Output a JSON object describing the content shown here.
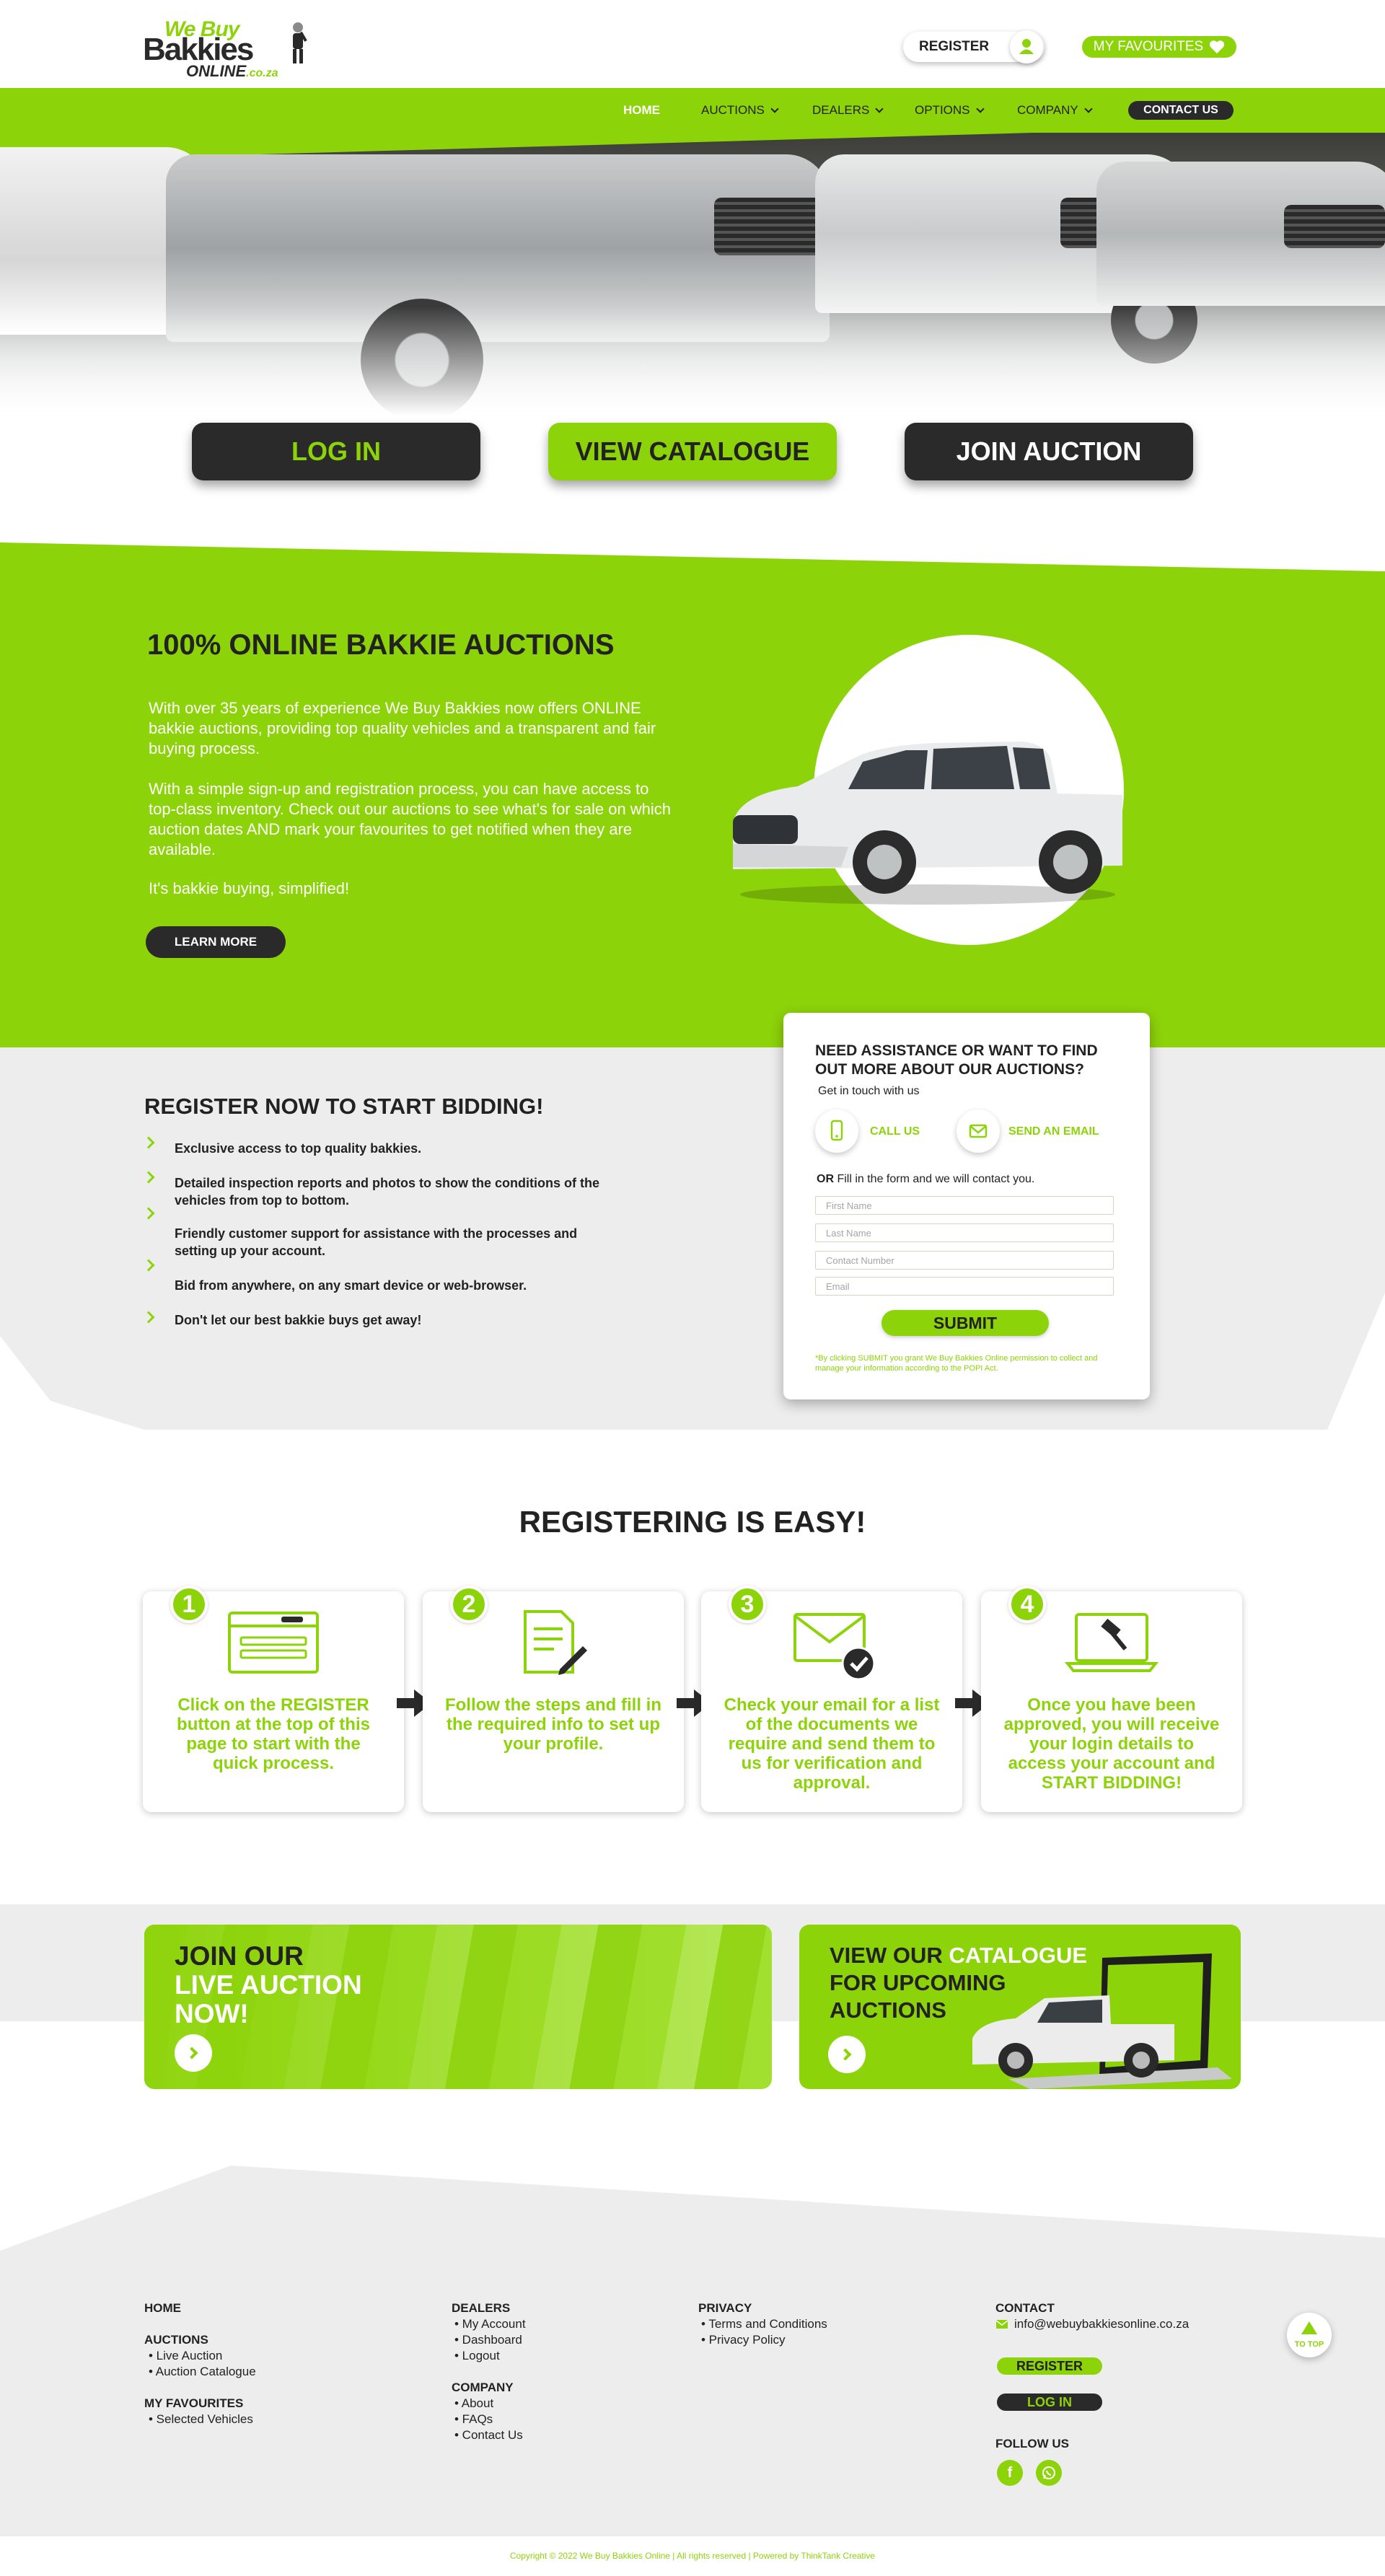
{
  "brand": {
    "logo_line1": "We Buy",
    "logo_line2": "Bakkies",
    "logo_line3": "ONLINE",
    "logo_domain": ".co.za",
    "accent_color": "#8dd30a",
    "dark_color": "#2a2a2a"
  },
  "header": {
    "register_label": "REGISTER",
    "favourites_label": "MY FAVOURITES"
  },
  "nav": {
    "home": "HOME",
    "auctions": "AUCTIONS",
    "dealers": "DEALERS",
    "options": "OPTIONS",
    "company": "COMPANY",
    "contact": "CONTACT US"
  },
  "hero": {
    "login": "LOG IN",
    "catalogue": "VIEW CATALOGUE",
    "join": "JOIN AUCTION"
  },
  "intro": {
    "title": "100% ONLINE BAKKIE AUCTIONS",
    "p1": "With over 35 years of experience We Buy Bakkies now offers ONLINE bakkie auctions, providing top quality vehicles and a transparent and fair buying process.",
    "p2": "With a simple sign-up and registration process, you can have access to top-class inventory. Check out our auctions to see what's for sale on which auction dates AND mark your favourites to get notified when they are available.",
    "p3": "It's bakkie buying, simplified!",
    "learn_more": "LEARN MORE"
  },
  "register_section": {
    "title": "REGISTER NOW TO START BIDDING!",
    "items": [
      "Exclusive access to top quality bakkies.",
      "Detailed inspection reports and photos to show the conditions of the vehicles from top to bottom.",
      "Friendly customer support for assistance with the processes and setting up your account.",
      "Bid from anywhere, on any smart device or web-browser.",
      "Don't let our best bakkie buys get away!"
    ]
  },
  "contact_form": {
    "title": "NEED ASSISTANCE OR WANT TO FIND OUT MORE ABOUT OUR AUCTIONS?",
    "subtitle": "Get in touch with us",
    "call_label": "CALL US",
    "email_label": "SEND AN EMAIL",
    "or_word": "OR",
    "or_text": " Fill in the form and we will contact you.",
    "fields": {
      "first_name": "First Name",
      "last_name": "Last Name",
      "contact_number": "Contact Number",
      "email": "Email"
    },
    "submit": "SUBMIT",
    "note": "*By clicking SUBMIT you grant We Buy Bakkies Online permission to collect and manage your information according to the POPI Act."
  },
  "steps": {
    "title": "REGISTERING IS EASY!",
    "items": [
      {
        "num": "1",
        "text": "Click on the REGISTER button at the top of this page to start with the quick process."
      },
      {
        "num": "2",
        "text": "Follow the steps and fill in the required info to set up your profile."
      },
      {
        "num": "3",
        "text": "Check your email for a list of the documents we require and send them to us for verification and approval."
      },
      {
        "num": "4",
        "text": "Once you have been approved, you will receive your login details to access your account and START BIDDING!"
      }
    ]
  },
  "cta": {
    "live_line1": "JOIN OUR",
    "live_line2": "LIVE AUCTION",
    "live_line3": "NOW!",
    "cat_line1_a": "VIEW OUR ",
    "cat_line1_b": "CATALOGUE",
    "cat_line2": "FOR UPCOMING",
    "cat_line3": "AUCTIONS"
  },
  "footer": {
    "home": "HOME",
    "auctions": "AUCTIONS",
    "live_auction": "• Live Auction",
    "auction_catalogue": "• Auction Catalogue",
    "my_favourites": "MY FAVOURITES",
    "selected_vehicles": "• Selected Vehicles",
    "dealers": "DEALERS",
    "my_account": "• My Account",
    "dashboard": "• Dashboard",
    "logout": "• Logout",
    "company": "COMPANY",
    "about": "• About",
    "faqs": "• FAQs",
    "contact_us": "• Contact Us",
    "privacy": "PRIVACY",
    "terms": "• Terms and Conditions",
    "privacy_policy": "• Privacy Policy",
    "contact": "CONTACT",
    "email": "info@webuybakkiesonline.co.za",
    "register": "REGISTER",
    "login": "LOG IN",
    "follow_us": "FOLLOW US",
    "to_top": "TO TOP",
    "copyright": "Copyright © 2022 We Buy Bakkies Online | All rights reserved | Powered by ThinkTank Creative"
  }
}
